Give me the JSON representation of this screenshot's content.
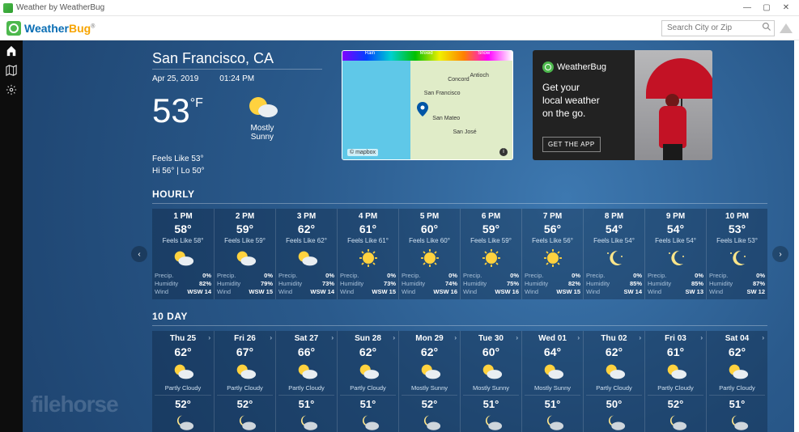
{
  "window": {
    "title": "Weather by WeatherBug"
  },
  "brand": {
    "part1": "Weather",
    "part2": "Bug"
  },
  "search": {
    "placeholder": "Search City or Zip"
  },
  "location": {
    "name": "San Francisco, CA",
    "date": "Apr 25, 2019",
    "time": "01:24 PM",
    "temp": "53",
    "temp_unit": "°F",
    "condition": "Mostly\nSunny",
    "feels_like": "Feels Like 53°",
    "hilo": "Hi 56° | Lo 50°"
  },
  "map": {
    "legend": [
      "Rain",
      "Mixed",
      "Snow"
    ],
    "cities": [
      "San Francisco",
      "San Mateo",
      "San José",
      "Antioch",
      "Concord"
    ],
    "attribution": "© mapbox"
  },
  "promo": {
    "brand": "WeatherBug",
    "line1": "Get your",
    "line2": "local weather",
    "line3": "on the go.",
    "cta": "GET THE APP"
  },
  "sections": {
    "hourly": "HOURLY",
    "tenday": "10 DAY"
  },
  "labels": {
    "feels_prefix": "Feels Like ",
    "precip": "Precip.",
    "humidity": "Humidity",
    "wind": "Wind"
  },
  "hourly": [
    {
      "time": "1 PM",
      "temp": "58°",
      "feel": "58°",
      "icon": "partly-sunny",
      "precip": "0%",
      "humidity": "82%",
      "wind": "WSW 14"
    },
    {
      "time": "2 PM",
      "temp": "59°",
      "feel": "59°",
      "icon": "partly-sunny",
      "precip": "0%",
      "humidity": "79%",
      "wind": "WSW 15"
    },
    {
      "time": "3 PM",
      "temp": "62°",
      "feel": "62°",
      "icon": "partly-sunny",
      "precip": "0%",
      "humidity": "73%",
      "wind": "WSW 14"
    },
    {
      "time": "4 PM",
      "temp": "61°",
      "feel": "61°",
      "icon": "sunny",
      "precip": "0%",
      "humidity": "73%",
      "wind": "WSW 15"
    },
    {
      "time": "5 PM",
      "temp": "60°",
      "feel": "60°",
      "icon": "sunny",
      "precip": "0%",
      "humidity": "74%",
      "wind": "WSW 16"
    },
    {
      "time": "6 PM",
      "temp": "59°",
      "feel": "59°",
      "icon": "sunny",
      "precip": "0%",
      "humidity": "75%",
      "wind": "WSW 16"
    },
    {
      "time": "7 PM",
      "temp": "56°",
      "feel": "56°",
      "icon": "sunny",
      "precip": "0%",
      "humidity": "82%",
      "wind": "WSW 15"
    },
    {
      "time": "8 PM",
      "temp": "54°",
      "feel": "54°",
      "icon": "night",
      "precip": "0%",
      "humidity": "85%",
      "wind": "SW 14"
    },
    {
      "time": "9 PM",
      "temp": "54°",
      "feel": "54°",
      "icon": "night",
      "precip": "0%",
      "humidity": "85%",
      "wind": "SW 13"
    },
    {
      "time": "10 PM",
      "temp": "53°",
      "feel": "53°",
      "icon": "night",
      "precip": "0%",
      "humidity": "87%",
      "wind": "SW 12"
    }
  ],
  "tenday": [
    {
      "day": "Thu 25",
      "hi": "62°",
      "cond": "Partly Cloudy",
      "icon": "partly-sunny",
      "lo": "52°",
      "night_icon": "night-cloudy"
    },
    {
      "day": "Fri 26",
      "hi": "67°",
      "cond": "Partly Cloudy",
      "icon": "partly-sunny",
      "lo": "52°",
      "night_icon": "night-cloudy"
    },
    {
      "day": "Sat 27",
      "hi": "66°",
      "cond": "Partly Cloudy",
      "icon": "partly-sunny",
      "lo": "51°",
      "night_icon": "night-cloudy"
    },
    {
      "day": "Sun 28",
      "hi": "62°",
      "cond": "Partly Cloudy",
      "icon": "partly-sunny",
      "lo": "51°",
      "night_icon": "night-cloudy"
    },
    {
      "day": "Mon 29",
      "hi": "62°",
      "cond": "Mostly Sunny",
      "icon": "mostly-sunny",
      "lo": "52°",
      "night_icon": "night-cloudy"
    },
    {
      "day": "Tue 30",
      "hi": "60°",
      "cond": "Mostly Sunny",
      "icon": "mostly-sunny",
      "lo": "51°",
      "night_icon": "night-cloudy"
    },
    {
      "day": "Wed 01",
      "hi": "64°",
      "cond": "Mostly Sunny",
      "icon": "mostly-sunny",
      "lo": "51°",
      "night_icon": "night-cloudy"
    },
    {
      "day": "Thu 02",
      "hi": "62°",
      "cond": "Partly Cloudy",
      "icon": "partly-sunny",
      "lo": "50°",
      "night_icon": "night-cloudy"
    },
    {
      "day": "Fri 03",
      "hi": "61°",
      "cond": "Partly Cloudy",
      "icon": "partly-sunny",
      "lo": "52°",
      "night_icon": "night-cloudy"
    },
    {
      "day": "Sat 04",
      "hi": "62°",
      "cond": "Partly Cloudy",
      "icon": "partly-sunny",
      "lo": "51°",
      "night_icon": "night-cloudy"
    }
  ],
  "watermark": "filehorse"
}
